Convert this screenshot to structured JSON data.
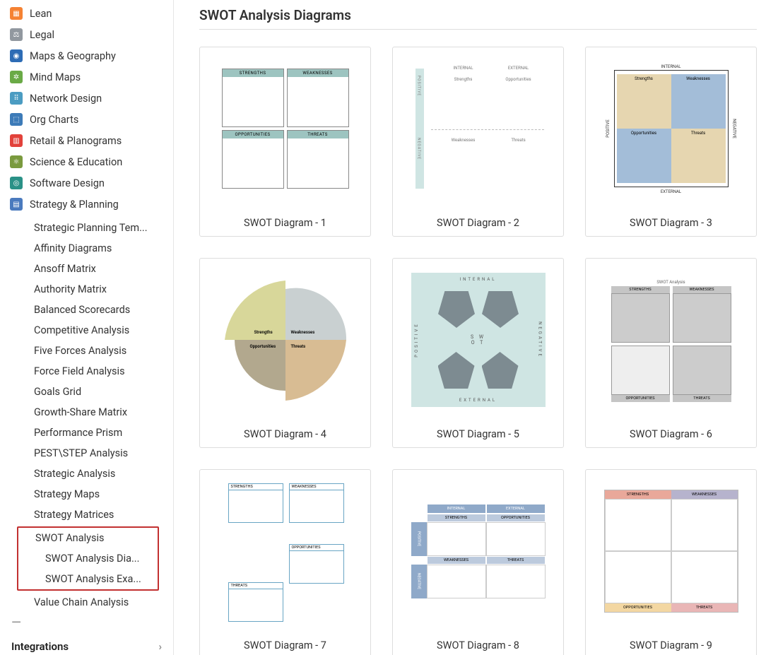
{
  "page_title": "SWOT Analysis Diagrams",
  "sidebar": {
    "categories": [
      {
        "id": "lean",
        "label": "Lean",
        "bg": "#f58233",
        "glyph": "▦"
      },
      {
        "id": "legal",
        "label": "Legal",
        "bg": "#91989f",
        "glyph": "⚖"
      },
      {
        "id": "maps",
        "label": "Maps & Geography",
        "bg": "#2d6cb5",
        "glyph": "◉"
      },
      {
        "id": "mind",
        "label": "Mind Maps",
        "bg": "#6aaa46",
        "glyph": "✲"
      },
      {
        "id": "network",
        "label": "Network Design",
        "bg": "#4b9cc2",
        "glyph": "⠿"
      },
      {
        "id": "org",
        "label": "Org Charts",
        "bg": "#3d7bb8",
        "glyph": "⬚"
      },
      {
        "id": "retail",
        "label": "Retail & Planograms",
        "bg": "#e2423b",
        "glyph": "▥"
      },
      {
        "id": "science",
        "label": "Science & Education",
        "bg": "#7a9a3e",
        "glyph": "⚛"
      },
      {
        "id": "software",
        "label": "Software Design",
        "bg": "#2a9187",
        "glyph": "◎"
      },
      {
        "id": "strategy",
        "label": "Strategy & Planning",
        "bg": "#4a7abe",
        "glyph": "▤"
      }
    ],
    "strategy_children": [
      "Strategic Planning Tem...",
      "Affinity Diagrams",
      "Ansoff Matrix",
      "Authority Matrix",
      "Balanced Scorecards",
      "Competitive Analysis",
      "Five Forces Analysis",
      "Force Field Analysis",
      "Goals Grid",
      "Growth-Share Matrix",
      "Performance Prism",
      "PEST\\STEP Analysis",
      "Strategic Analysis",
      "Strategy Maps",
      "Strategy Matrices"
    ],
    "swot_section": {
      "parent": "SWOT Analysis",
      "children": [
        "SWOT Analysis Dia...",
        "SWOT Analysis Exa..."
      ]
    },
    "after_swot": [
      "Value Chain Analysis"
    ],
    "integrations": "Integrations"
  },
  "templates": [
    {
      "label": "SWOT Diagram - 1"
    },
    {
      "label": "SWOT Diagram - 2"
    },
    {
      "label": "SWOT Diagram - 3"
    },
    {
      "label": "SWOT Diagram - 4"
    },
    {
      "label": "SWOT Diagram - 5"
    },
    {
      "label": "SWOT Diagram - 6"
    },
    {
      "label": "SWOT Diagram - 7"
    },
    {
      "label": "SWOT Diagram - 8"
    },
    {
      "label": "SWOT Diagram - 9"
    }
  ],
  "thumb_text": {
    "strengths": "STRENGTHS",
    "weaknesses": "WEAKNESSES",
    "opportunities": "OPPORTUNITIES",
    "threats": "THREATS",
    "internal": "INTERNAL",
    "external": "EXTERNAL",
    "positive": "POSITIVE",
    "negative": "NEGATIVE",
    "s": "Strengths",
    "w": "Weaknesses",
    "o": "Opportunities",
    "t": "Threats",
    "swot_title": "SWOT Analysis",
    "s_b": "Strengths",
    "w_b": "Weaknesses",
    "o_b": "Opportunities",
    "t_b": "Threats",
    "swot": "S W\nO T"
  }
}
